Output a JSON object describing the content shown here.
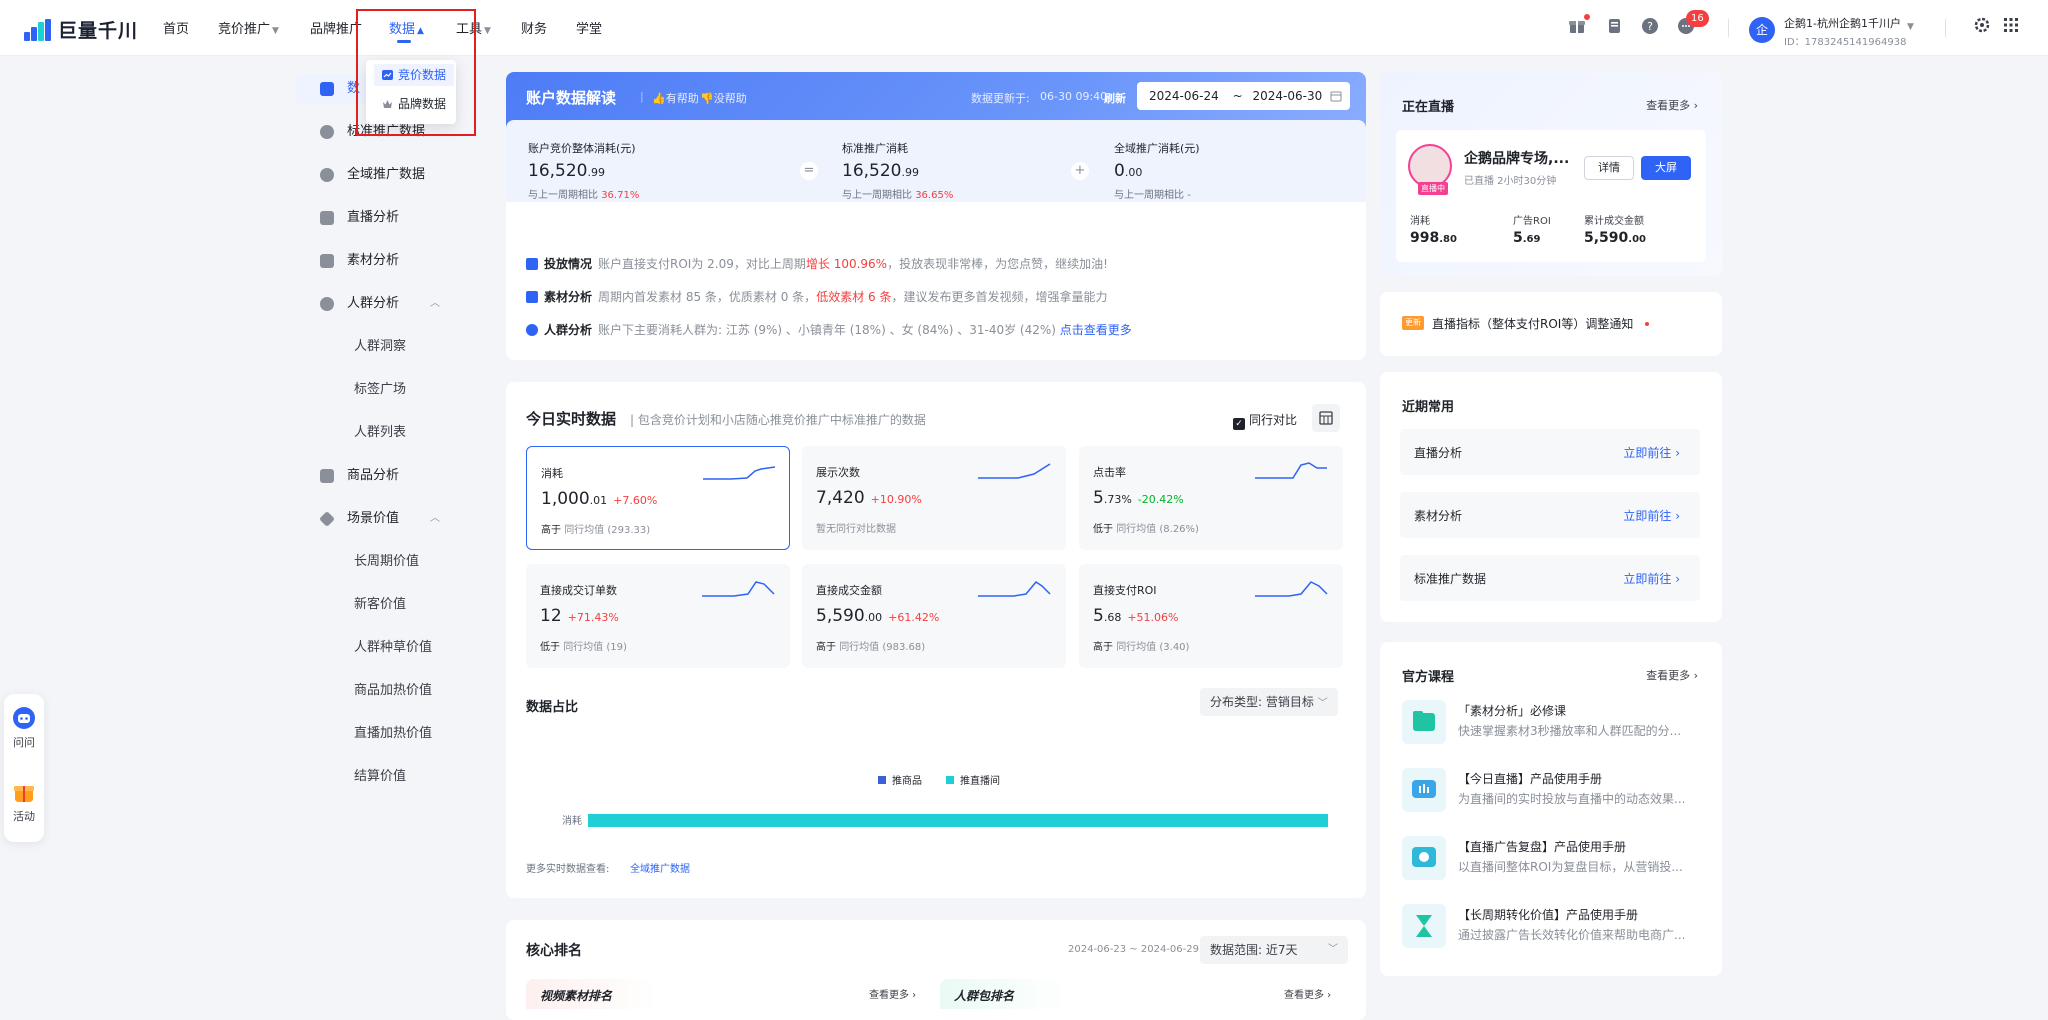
{
  "app": {
    "logo_text": "巨量千川"
  },
  "nav": {
    "items": [
      {
        "label": "首页"
      },
      {
        "label": "竞价推广"
      },
      {
        "label": "品牌推广"
      },
      {
        "label": "数据"
      },
      {
        "label": "工具"
      },
      {
        "label": "财务"
      },
      {
        "label": "学堂"
      }
    ],
    "notification_count": "16",
    "account_name": "企鹅1-杭州企鹅1千川户",
    "account_id": "ID：1783245141964938"
  },
  "dropdown": {
    "items": [
      {
        "label": "竞价数据",
        "selected": true
      },
      {
        "label": "品牌数据",
        "selected": false
      }
    ]
  },
  "sidebar": {
    "items": [
      {
        "label": "数"
      },
      {
        "label": "标准推广数据"
      },
      {
        "label": "全域推广数据"
      },
      {
        "label": "直播分析"
      },
      {
        "label": "素材分析"
      },
      {
        "label": "人群分析"
      },
      {
        "label": "人群洞察"
      },
      {
        "label": "标签广场"
      },
      {
        "label": "人群列表"
      },
      {
        "label": "商品分析"
      },
      {
        "label": "场景价值"
      },
      {
        "label": "长周期价值"
      },
      {
        "label": "新客价值"
      },
      {
        "label": "人群种草价值"
      },
      {
        "label": "商品加热价值"
      },
      {
        "label": "直播加热价值"
      },
      {
        "label": "结算价值"
      }
    ]
  },
  "float": {
    "ask": "问问",
    "activity": "活动"
  },
  "hero": {
    "title": "账户数据解读",
    "helpful": "有帮助",
    "not_helpful": "没帮助",
    "update_label": "数据更新于:",
    "update_time": "06-30 09:40",
    "refresh": "刷新",
    "date_start": "2024-06-24",
    "date_sep": "~",
    "date_end": "2024-06-30",
    "metrics": [
      {
        "title": "账户竞价整体消耗(元)",
        "int": "16,520",
        "dec": ".99",
        "cmp_label": "与上一周期相比",
        "cmp": "36.71%"
      },
      {
        "title": "标准推广消耗",
        "int": "16,520",
        "dec": ".99",
        "cmp_label": "与上一周期相比",
        "cmp": "36.65%"
      },
      {
        "title": "全域推广消耗(元)",
        "int": "0",
        "dec": ".00",
        "cmp_label": "与上一周期相比",
        "cmp": "-"
      }
    ],
    "op_equal": "=",
    "op_plus": "+",
    "insights": [
      {
        "title": "投放情况",
        "p1": "账户直接支付ROI为 2.09，对比上周期",
        "hl": "增长 100.96%",
        "p2": "，投放表现非常棒，为您点赞，继续加油!"
      },
      {
        "title": "素材分析",
        "p1": "周期内首发素材 85 条，优质素材 0 条，",
        "hl": "低效素材 6 条",
        "p2": "，建议发布更多首发视频，增强拿量能力"
      },
      {
        "title": "人群分析",
        "p1": "账户下主要消耗人群为: 江苏 (9%) 、小镇青年 (18%) 、女 (84%) 、31-40岁 (42%)",
        "link": "点击查看更多"
      }
    ]
  },
  "today": {
    "title": "今日实时数据",
    "subtitle": "包含竞价计划和小店随心推竞价推广中标准推广的数据",
    "peer_compare": "同行对比",
    "kpis": [
      {
        "title": "消耗",
        "int": "1,000",
        "dec": ".01",
        "change": "+7.60%",
        "dir": "up",
        "cmp_a": "高于",
        "cmp_b": "同行均值",
        "cmp_c": "(293.33)"
      },
      {
        "title": "展示次数",
        "int": "7,420",
        "dec": "",
        "change": "+10.90%",
        "dir": "up",
        "cmp_a": "",
        "cmp_b": "暂无同行对比数据",
        "cmp_c": ""
      },
      {
        "title": "点击率",
        "int": "5",
        "dec": ".73%",
        "change": "-20.42%",
        "dir": "down",
        "cmp_a": "低于",
        "cmp_b": "同行均值",
        "cmp_c": "(8.26%)"
      },
      {
        "title": "直接成交订单数",
        "int": "12",
        "dec": "",
        "change": "+71.43%",
        "dir": "up",
        "cmp_a": "低于",
        "cmp_b": "同行均值",
        "cmp_c": "(19)"
      },
      {
        "title": "直接成交金额",
        "int": "5,590",
        "dec": ".00",
        "change": "+61.42%",
        "dir": "up",
        "cmp_a": "高于",
        "cmp_b": "同行均值",
        "cmp_c": "(983.68)"
      },
      {
        "title": "直接支付ROI",
        "int": "5",
        "dec": ".68",
        "change": "+51.06%",
        "dir": "up",
        "cmp_a": "高于",
        "cmp_b": "同行均值",
        "cmp_c": "(3.40)"
      }
    ],
    "share_title": "数据占比",
    "dist_select": "分布类型: 营销目标",
    "more_label": "更多实时数据查看:",
    "more_link": "全域推广数据"
  },
  "chart_data": {
    "type": "bar",
    "orientation": "horizontal",
    "stacked": true,
    "categories": [
      "消耗"
    ],
    "series": [
      {
        "name": "推商品",
        "values": [
          0
        ],
        "color": "#3d5fd9"
      },
      {
        "name": "推直播间",
        "values": [
          100
        ],
        "color": "#1fcfd6"
      }
    ],
    "x_ticks": [
      "0",
      "20%",
      "40%",
      "60%",
      "80%",
      "100%"
    ],
    "xlim": [
      0,
      100
    ],
    "legend": "top-center"
  },
  "rank": {
    "title": "核心排名",
    "date_range": "2024-06-23 ~ 2024-06-29",
    "scope_select": "数据范围: 近7天",
    "tab1": "视频素材排名",
    "tab2": "人群包排名",
    "more": "查看更多"
  },
  "live": {
    "title": "正在直播",
    "more": "查看更多",
    "name": "企鹅品牌专场,...",
    "tag": "直播中",
    "duration": "已直播 2小时30分钟",
    "detail": "详情",
    "bigscreen": "大屏",
    "stats": [
      {
        "label": "消耗",
        "int": "998",
        "dec": ".80"
      },
      {
        "label": "广告ROI",
        "int": "5",
        "dec": ".69"
      },
      {
        "label": "累计成交金额",
        "int": "5,590",
        "dec": ".00"
      }
    ]
  },
  "notice": {
    "tag": "更新",
    "text": "直播指标（整体支付ROI等）调整通知"
  },
  "recent": {
    "title": "近期常用",
    "go": "立即前往",
    "items": [
      {
        "label": "直播分析"
      },
      {
        "label": "素材分析"
      },
      {
        "label": "标准推广数据"
      }
    ]
  },
  "courses": {
    "title": "官方课程",
    "more": "查看更多",
    "items": [
      {
        "title": "「素材分析」必修课",
        "desc": "快速掌握素材3秒播放率和人群匹配的分..."
      },
      {
        "title": "【今日直播】产品使用手册",
        "desc": "为直播间的实时投放与直播中的动态效果..."
      },
      {
        "title": "【直播广告复盘】产品使用手册",
        "desc": "以直播间整体ROI为复盘目标，从营销投..."
      },
      {
        "title": "【长周期转化价值】产品使用手册",
        "desc": "通过披露广告长效转化价值来帮助电商广..."
      }
    ]
  },
  "colors": {
    "accent": "#2e63f5",
    "up": "#f53f3f",
    "down": "#00b42a",
    "bar": "#1fcfd6"
  }
}
